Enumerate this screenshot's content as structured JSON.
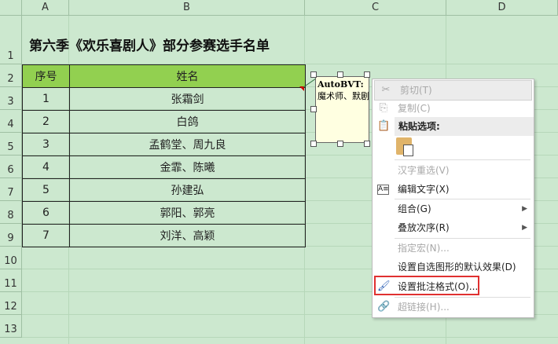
{
  "columns": [
    "A",
    "B",
    "C",
    "D"
  ],
  "rows": [
    "1",
    "2",
    "3",
    "4",
    "5",
    "6",
    "7",
    "8",
    "9",
    "10",
    "11",
    "12",
    "13"
  ],
  "title": "第六季《欢乐喜剧人》部分参赛选手名单",
  "table": {
    "headers": [
      "序号",
      "姓名"
    ],
    "data": [
      [
        "1",
        "张霜剑"
      ],
      [
        "2",
        "白鸽"
      ],
      [
        "3",
        "孟鹤堂、周九良"
      ],
      [
        "4",
        "金霏、陈曦"
      ],
      [
        "5",
        "孙建弘"
      ],
      [
        "6",
        "郭阳、郭亮"
      ],
      [
        "7",
        "刘洋、高颖"
      ]
    ]
  },
  "comment": {
    "author": "AutoBVT:",
    "text": "魔术师、默剧"
  },
  "menu": {
    "cut": "剪切(T)",
    "copy": "复制(C)",
    "paste_options": "粘贴选项:",
    "reconvert": "汉字重选(V)",
    "edit_text": "编辑文字(X)",
    "group": "组合(G)",
    "order": "叠放次序(R)",
    "macro": "指定宏(N)...",
    "default_shape": "设置自选图形的默认效果(D)",
    "format_comment": "设置批注格式(O)...",
    "hyperlink": "超链接(H)..."
  },
  "colors": {
    "header_fill": "#92d050",
    "sheet_bg": "#cce8cf",
    "highlight": "#e03030"
  }
}
